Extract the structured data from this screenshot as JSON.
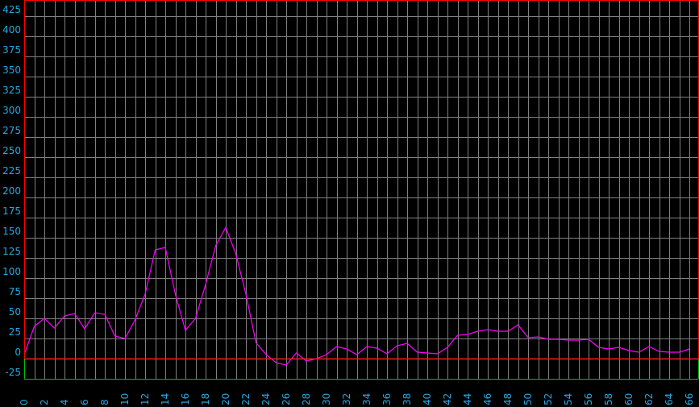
{
  "chart_data": {
    "type": "line",
    "title": "",
    "xlabel": "",
    "ylabel": "",
    "xlim": [
      0,
      66.5
    ],
    "ylim": [
      -25,
      440
    ],
    "grid": true,
    "y_ticks": [
      -25,
      0,
      25,
      50,
      75,
      100,
      125,
      150,
      175,
      200,
      225,
      250,
      275,
      300,
      325,
      350,
      375,
      400,
      425
    ],
    "x_ticks": [
      0,
      2,
      4,
      6,
      8,
      10,
      12,
      14,
      16,
      18,
      20,
      22,
      24,
      26,
      28,
      30,
      32,
      34,
      36,
      38,
      40,
      42,
      44,
      46,
      48,
      50,
      52,
      54,
      56,
      58,
      60,
      62,
      64,
      66
    ],
    "colors": {
      "background": "#000000",
      "grid": "#808080",
      "line": "#ff00ff",
      "tick_labels": "#2aa8e0",
      "baseline": "#00c000",
      "frame": "#ff0000"
    },
    "series": [
      {
        "x": [
          0,
          1,
          2,
          3,
          4,
          5,
          6,
          7,
          8,
          9,
          10,
          11,
          12,
          13,
          14,
          15,
          16,
          17,
          18,
          19,
          20,
          21,
          22,
          23,
          24,
          25,
          26,
          27,
          28,
          29,
          30,
          31,
          32,
          33,
          34,
          35,
          36,
          37,
          38,
          39,
          40,
          41,
          42,
          43,
          44,
          45,
          46,
          47,
          48,
          49,
          50,
          51,
          52,
          53,
          54,
          55,
          56,
          57,
          58,
          59,
          60,
          61,
          62,
          63,
          64,
          65,
          66
        ],
        "y": [
          5,
          40,
          50,
          38,
          53,
          56,
          37,
          57,
          55,
          28,
          25,
          48,
          80,
          135,
          138,
          80,
          35,
          50,
          92,
          140,
          163,
          130,
          80,
          20,
          5,
          -5,
          -8,
          7,
          -3,
          0,
          5,
          15,
          12,
          5,
          15,
          13,
          6,
          16,
          19,
          8,
          7,
          6,
          14,
          29,
          30,
          34,
          36,
          34,
          34,
          42,
          26,
          27,
          24,
          24,
          23,
          23,
          24,
          14,
          12,
          14,
          10,
          8,
          15,
          9,
          8,
          8,
          12
        ]
      }
    ]
  }
}
